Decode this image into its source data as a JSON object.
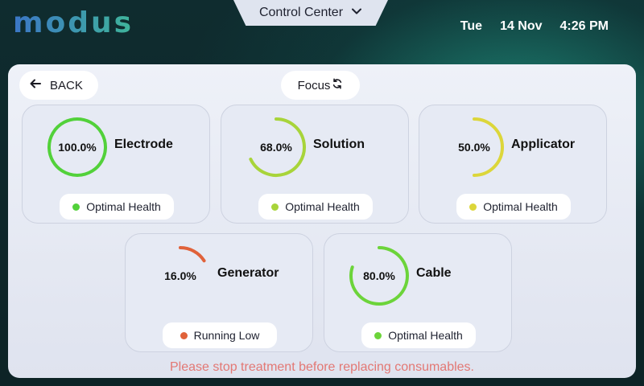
{
  "app": {
    "logo": "modus"
  },
  "header": {
    "control_center_label": "Control Center",
    "day": "Tue",
    "date": "14 Nov",
    "time": "4:26 PM"
  },
  "toolbar": {
    "back_label": "BACK",
    "focus_label": "Focus"
  },
  "consumables": [
    {
      "name": "Electrode",
      "percent": 100.0,
      "percent_label": "100.0%",
      "status": "Optimal Health",
      "color": "#52d13a"
    },
    {
      "name": "Solution",
      "percent": 68.0,
      "percent_label": "68.0%",
      "status": "Optimal Health",
      "color": "#a8d43a"
    },
    {
      "name": "Applicator",
      "percent": 50.0,
      "percent_label": "50.0%",
      "status": "Optimal Health",
      "color": "#dcd63a"
    },
    {
      "name": "Generator",
      "percent": 16.0,
      "percent_label": "16.0%",
      "status": "Running Low",
      "color": "#e0623a"
    },
    {
      "name": "Cable",
      "percent": 80.0,
      "percent_label": "80.0%",
      "status": "Optimal Health",
      "color": "#6cd43a"
    }
  ],
  "warning": "Please stop treatment before replacing consumables."
}
